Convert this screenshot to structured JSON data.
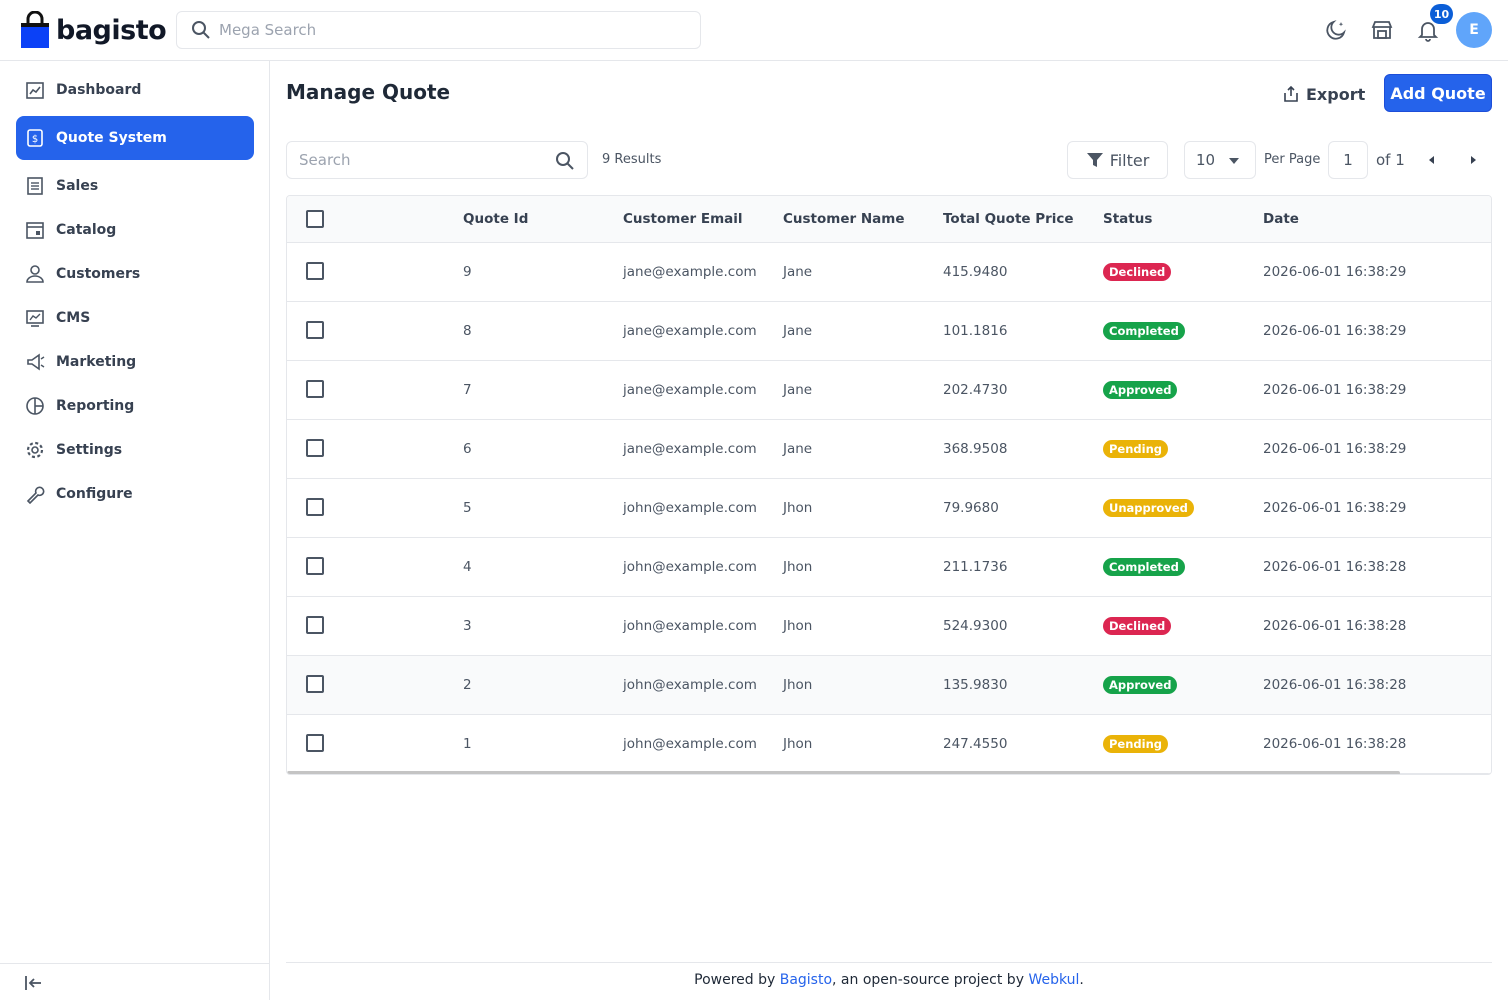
{
  "brand": {
    "name": "bagisto",
    "color": "#0b41f7"
  },
  "header": {
    "search_placeholder": "Mega Search",
    "notification_count": "10",
    "avatar_initial": "E"
  },
  "sidebar": {
    "items": [
      {
        "label": "Dashboard",
        "icon": "dashboard-icon"
      },
      {
        "label": "Quote System",
        "icon": "quote-icon",
        "active": true
      },
      {
        "label": "Sales",
        "icon": "sales-icon"
      },
      {
        "label": "Catalog",
        "icon": "catalog-icon"
      },
      {
        "label": "Customers",
        "icon": "customers-icon"
      },
      {
        "label": "CMS",
        "icon": "cms-icon"
      },
      {
        "label": "Marketing",
        "icon": "marketing-icon"
      },
      {
        "label": "Reporting",
        "icon": "reporting-icon"
      },
      {
        "label": "Settings",
        "icon": "settings-icon"
      },
      {
        "label": "Configure",
        "icon": "configure-icon"
      }
    ]
  },
  "page": {
    "title": "Manage Quote",
    "export_label": "Export",
    "add_label": "Add Quote"
  },
  "toolbar": {
    "search_placeholder": "Search",
    "results": "9 Results",
    "filter_label": "Filter",
    "per_page_value": "10",
    "per_page_label": "Per Page",
    "page_value": "1",
    "of_label": "of 1"
  },
  "table": {
    "columns": [
      "Quote Id",
      "Customer Email",
      "Customer Name",
      "Total Quote Price",
      "Status",
      "Date"
    ],
    "rows": [
      {
        "id": "9",
        "email": "jane@example.com",
        "name": "Jane",
        "price": "415.9480",
        "status": "Declined",
        "date": "2026-06-01 16:38:29"
      },
      {
        "id": "8",
        "email": "jane@example.com",
        "name": "Jane",
        "price": "101.1816",
        "status": "Completed",
        "date": "2026-06-01 16:38:29"
      },
      {
        "id": "7",
        "email": "jane@example.com",
        "name": "Jane",
        "price": "202.4730",
        "status": "Approved",
        "date": "2026-06-01 16:38:29"
      },
      {
        "id": "6",
        "email": "jane@example.com",
        "name": "Jane",
        "price": "368.9508",
        "status": "Pending",
        "date": "2026-06-01 16:38:29"
      },
      {
        "id": "5",
        "email": "john@example.com",
        "name": "Jhon",
        "price": "79.9680",
        "status": "Unapproved",
        "date": "2026-06-01 16:38:29"
      },
      {
        "id": "4",
        "email": "john@example.com",
        "name": "Jhon",
        "price": "211.1736",
        "status": "Completed",
        "date": "2026-06-01 16:38:28"
      },
      {
        "id": "3",
        "email": "john@example.com",
        "name": "Jhon",
        "price": "524.9300",
        "status": "Declined",
        "date": "2026-06-01 16:38:28"
      },
      {
        "id": "2",
        "email": "john@example.com",
        "name": "Jhon",
        "price": "135.9830",
        "status": "Approved",
        "date": "2026-06-01 16:38:28"
      },
      {
        "id": "1",
        "email": "john@example.com",
        "name": "Jhon",
        "price": "247.4550",
        "status": "Pending",
        "date": "2026-06-01 16:38:28"
      }
    ],
    "status_colors": {
      "Declined": "#dc2651",
      "Completed": "#16a34a",
      "Approved": "#16a34a",
      "Pending": "#eab308",
      "Unapproved": "#eab308"
    }
  },
  "footer": {
    "prefix": "Powered by ",
    "link1": "Bagisto",
    "middle": ", an open-source project by ",
    "link2": "Webkul",
    "suffix": "."
  }
}
